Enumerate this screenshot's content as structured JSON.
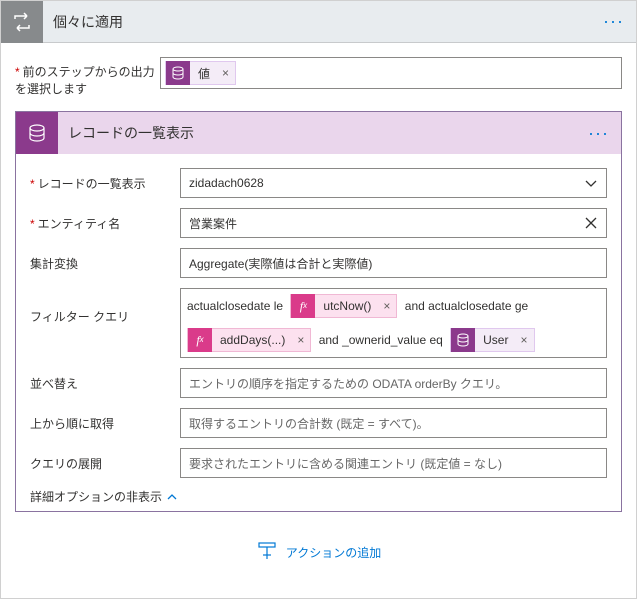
{
  "outer": {
    "title": "個々に適用",
    "menu": "···"
  },
  "prevOutput": {
    "label": "前のステップからの出力を選択します",
    "token": {
      "label": "値"
    }
  },
  "inner": {
    "title": "レコードの一覧表示",
    "menu": "···"
  },
  "fields": {
    "list_label": "レコードの一覧表示",
    "list_value": "zidadach0628",
    "entity_label": "エンティティ名",
    "entity_value": "営業案件",
    "agg_label": "集計変換",
    "agg_value": "Aggregate(実際値は合計と実際値)",
    "filter_label": "フィルター クエリ",
    "filter": {
      "t1": "actualclosedate le ",
      "fx1": "utcNow()",
      "t2": " and actualclosedate ge",
      "fx2": "addDays(...)",
      "t3": " and _ownerid_value eq ",
      "tok": "User"
    },
    "order_label": "並べ替え",
    "order_ph": "エントリの順序を指定するための ODATA orderBy クエリ。",
    "top_label": "上から順に取得",
    "top_ph": "取得するエントリの合計数 (既定 = すべて)。",
    "expand_label": "クエリの展開",
    "expand_ph": "要求されたエントリに含める関連エントリ (既定値 = なし)"
  },
  "hide_advanced": "詳細オプションの非表示",
  "add_action": "アクションの追加"
}
